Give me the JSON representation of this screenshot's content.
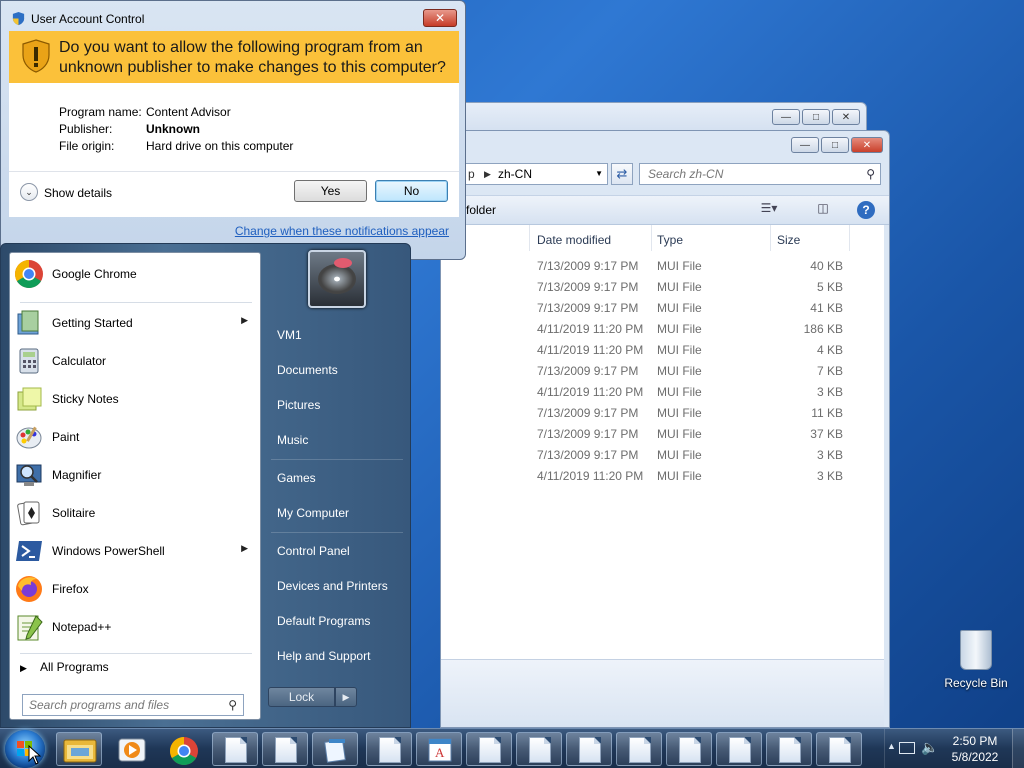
{
  "uac": {
    "title": "User Account Control",
    "question": "Do you want to allow the following program from an unknown publisher to make changes to this computer?",
    "program_name_label": "Program name:",
    "program_name": "Content Advisor",
    "publisher_label": "Publisher:",
    "publisher": "Unknown",
    "file_origin_label": "File origin:",
    "file_origin": "Hard drive on this computer",
    "show_details": "Show details",
    "yes_label": "Yes",
    "no_label": "No",
    "change_link": "Change when these notifications appear"
  },
  "explorer": {
    "address_folder": "zh-CN",
    "address_prefix": "p",
    "search_placeholder": "Search zh-CN",
    "toolbar_partial": "folder",
    "columns": [
      "Date modified",
      "Type",
      "Size"
    ],
    "files": [
      {
        "date": "7/13/2009 9:17 PM",
        "type": "MUI File",
        "size": "40 KB"
      },
      {
        "date": "7/13/2009 9:17 PM",
        "type": "MUI File",
        "size": "5 KB"
      },
      {
        "date": "7/13/2009 9:17 PM",
        "type": "MUI File",
        "size": "41 KB"
      },
      {
        "date": "4/11/2019 11:20 PM",
        "type": "MUI File",
        "size": "186 KB"
      },
      {
        "date": "4/11/2019 11:20 PM",
        "type": "MUI File",
        "size": "4 KB"
      },
      {
        "date": "7/13/2009 9:17 PM",
        "type": "MUI File",
        "size": "7 KB"
      },
      {
        "date": "4/11/2019 11:20 PM",
        "type": "MUI File",
        "size": "3 KB"
      },
      {
        "date": "7/13/2009 9:17 PM",
        "type": "MUI File",
        "size": "11 KB"
      },
      {
        "date": "7/13/2009 9:17 PM",
        "type": "MUI File",
        "size": "37 KB"
      },
      {
        "date": "7/13/2009 9:17 PM",
        "type": "MUI File",
        "size": "3 KB"
      },
      {
        "date": "4/11/2019 11:20 PM",
        "type": "MUI File",
        "size": "3 KB"
      }
    ]
  },
  "start_menu": {
    "programs": [
      {
        "label": "Google Chrome",
        "icon": "chrome-icon",
        "submenu": false
      },
      {
        "label": "Getting Started",
        "icon": "getting-started-icon",
        "submenu": true
      },
      {
        "label": "Calculator",
        "icon": "calculator-icon",
        "submenu": false
      },
      {
        "label": "Sticky Notes",
        "icon": "sticky-notes-icon",
        "submenu": false
      },
      {
        "label": "Paint",
        "icon": "paint-icon",
        "submenu": false
      },
      {
        "label": "Magnifier",
        "icon": "magnifier-icon",
        "submenu": false
      },
      {
        "label": "Solitaire",
        "icon": "solitaire-icon",
        "submenu": false
      },
      {
        "label": "Windows PowerShell",
        "icon": "powershell-icon",
        "submenu": true
      },
      {
        "label": "Firefox",
        "icon": "firefox-icon",
        "submenu": false
      },
      {
        "label": "Notepad++",
        "icon": "notepadpp-icon",
        "submenu": false
      }
    ],
    "all_programs": "All Programs",
    "search_placeholder": "Search programs and files",
    "right_links": [
      "VM1",
      "Documents",
      "Pictures",
      "Music",
      "Games",
      "My Computer",
      "Control Panel",
      "Devices and Printers",
      "Default Programs",
      "Help and Support"
    ],
    "lock_label": "Lock"
  },
  "desktop": {
    "recycle_bin": "Recycle Bin"
  },
  "taskbar": {
    "time": "2:50 PM",
    "date": "5/8/2022"
  },
  "colors": {
    "uac_banner": "#fbc13a",
    "link": "#1f5fbf",
    "desktop": "#1d5fb5"
  }
}
